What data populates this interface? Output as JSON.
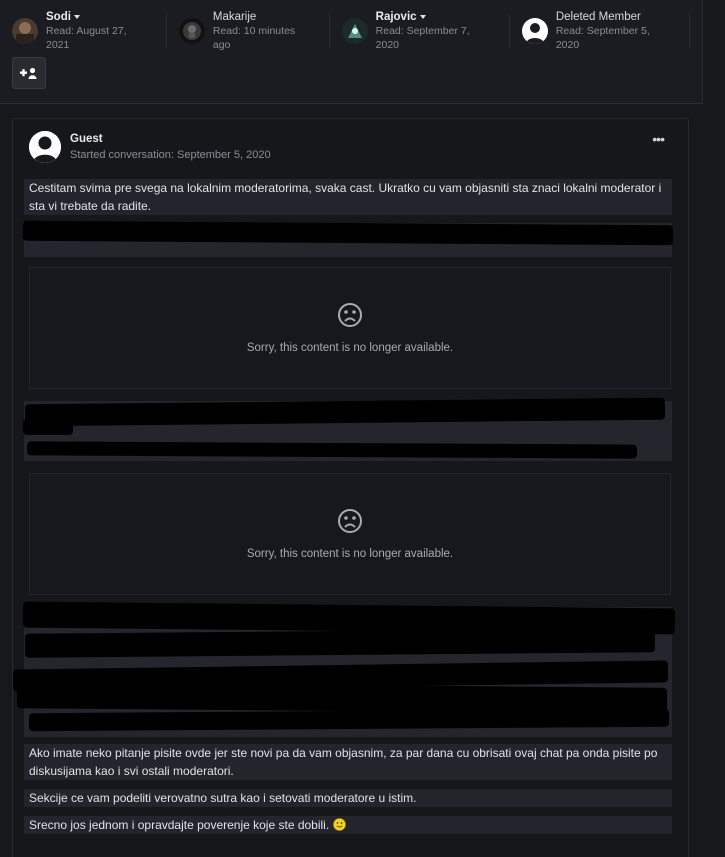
{
  "participants": [
    {
      "name": "Sodi",
      "read": "Read: August 27, 2021",
      "has_menu": true
    },
    {
      "name": "Makarije",
      "read": "Read: 10 minutes ago",
      "has_menu": false
    },
    {
      "name": "Rajovic",
      "read": "Read: September 7, 2020",
      "has_menu": true
    },
    {
      "name": "Deleted Member",
      "read": "Read: September 5, 2020",
      "has_menu": false
    }
  ],
  "add_participant_icon": "add-user-icon",
  "post": {
    "author": "Guest",
    "started": "Started conversation: September 5, 2020",
    "more_icon": "ellipsis-icon",
    "paragraphs": {
      "p1": "Cestitam svima pre svega na lokalnim moderatorima, svaka cast. Ukratko cu vam objasniti sta znaci lokalni moderator i sta vi trebate da radite.",
      "p2": "Ako imate neko pitanje pisite ovde jer ste novi pa da vam objasnim, za par dana cu obrisati ovaj chat pa onda pisite po diskusijama kao i svi ostali moderatori.",
      "p3": "Sekcije ce vam podeliti verovatno sutra kao i setovati moderatore u istim.",
      "p4": "Srecno jos jednom i opravdajte poverenje koje ste dobili."
    },
    "unavailable_1": "Sorry, this content is no longer available.",
    "unavailable_2": "Sorry, this content is no longer available."
  },
  "colors": {
    "background": "#17181c",
    "text_highlight": "#24252c",
    "emoji": "#f5d327"
  }
}
